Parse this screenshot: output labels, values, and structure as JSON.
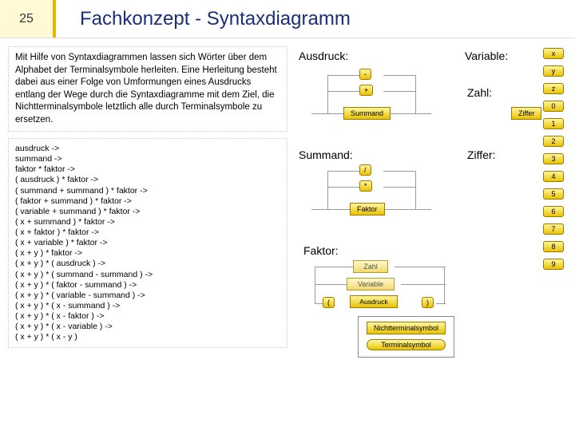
{
  "slide_number": "25",
  "title": "Fachkonzept - Syntaxdiagramm",
  "intro_text": "Mit Hilfe von Syntaxdiagrammen lassen sich Wörter über dem Alphabet der Terminalsymbole herleiten. Eine Herleitung besteht dabei aus einer Folge von Umformungen eines Ausdrucks entlang der Wege durch die Syntaxdiagramme mit dem Ziel, die Nichtterminalsymbole letztlich alle durch Terminalsymbole zu ersetzen.",
  "derivation": "ausdruck ->\nsummand ->\nfaktor * faktor ->\n( ausdruck ) * faktor ->\n( summand + summand ) * faktor ->\n( faktor + summand ) * faktor ->\n( variable + summand ) * faktor ->\n( x + summand ) * faktor ->\n( x + faktor ) * faktor ->\n( x + variable ) * faktor ->\n( x + y ) * faktor ->\n( x + y ) * ( ausdruck ) ->\n( x + y ) * ( summand - summand ) ->\n( x + y ) * ( faktor - summand ) ->\n( x + y ) * ( variable - summand ) ->\n( x + y ) * ( x - summand ) ->\n( x + y ) * ( x - faktor ) ->\n( x + y ) * ( x - variable ) ->\n( x + y ) * ( x - y )",
  "labels": {
    "ausdruck": "Ausdruck:",
    "summand": "Summand:",
    "faktor": "Faktor:",
    "variable": "Variable:",
    "zahl": "Zahl:",
    "ziffer": "Ziffer:"
  },
  "diagrams": {
    "ausdruck": {
      "ops": [
        "-",
        "+"
      ],
      "nonterm": "Summand"
    },
    "summand": {
      "ops": [
        "/",
        "*"
      ],
      "nonterm": "Faktor"
    },
    "faktor": {
      "alt1": "Zahl",
      "alt2": "Variable",
      "open": "(",
      "inner": "Ausdruck",
      "close": ")"
    },
    "zahl_nt": "Ziffer",
    "variable_terms": [
      "x",
      "y",
      "z"
    ],
    "ziffer_terms": [
      "0",
      "1",
      "2",
      "3",
      "4",
      "5",
      "6",
      "7",
      "8",
      "9"
    ]
  },
  "legend": {
    "nonterminal": "Nichtterminalsymbol",
    "terminal": "Terminalsymbol"
  }
}
